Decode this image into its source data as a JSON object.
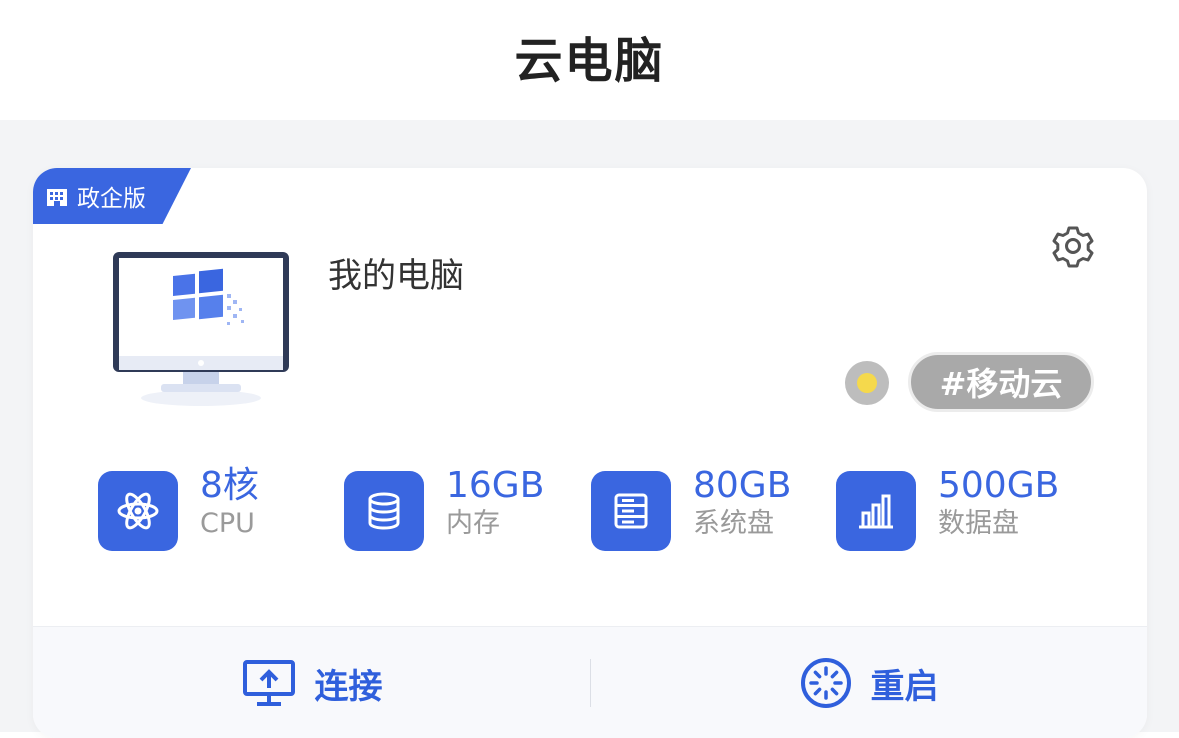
{
  "header": {
    "title": "云电脑"
  },
  "card": {
    "badge": {
      "label": "政企版",
      "icon": "building-icon"
    },
    "computer_name": "我的电脑",
    "settings_icon": "gear-icon",
    "status": {
      "color": "#f5d94c"
    },
    "tag": "#移动云",
    "specs": [
      {
        "value": "8核",
        "label": "CPU",
        "icon": "atom-icon"
      },
      {
        "value": "16GB",
        "label": "内存",
        "icon": "database-icon"
      },
      {
        "value": "80GB",
        "label": "系统盘",
        "icon": "disk-list-icon"
      },
      {
        "value": "500GB",
        "label": "数据盘",
        "icon": "bar-chart-icon"
      }
    ],
    "actions": {
      "connect": {
        "label": "连接",
        "icon": "monitor-upload-icon"
      },
      "restart": {
        "label": "重启",
        "icon": "spinner-icon"
      }
    }
  },
  "colors": {
    "accent": "#3a66e0",
    "tag_bg": "#a9a9a9",
    "background": "#f3f4f6"
  }
}
